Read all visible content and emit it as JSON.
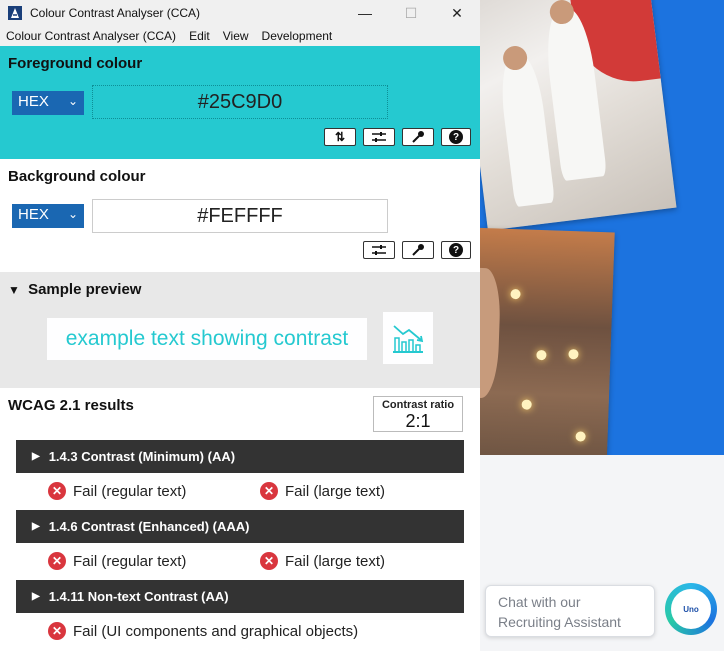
{
  "window": {
    "title": "Colour Contrast Analyser (CCA)",
    "controls": {
      "minimize": "—",
      "maximize": "☐",
      "close": "✕"
    }
  },
  "menu": [
    "Colour Contrast Analyser (CCA)",
    "Edit",
    "View",
    "Development"
  ],
  "foreground": {
    "title": "Foreground colour",
    "format": "HEX",
    "value": "#25C9D0",
    "color": "#25C9D0",
    "tools": [
      "swap-icon",
      "sliders-icon",
      "eyedropper-icon",
      "help-icon"
    ]
  },
  "background": {
    "title": "Background colour",
    "format": "HEX",
    "value": "#FEFFFF",
    "color": "#FEFFFF",
    "tools": [
      "sliders-icon",
      "eyedropper-icon",
      "help-icon"
    ]
  },
  "preview": {
    "title": "Sample preview",
    "toggle": "▼",
    "sample_text": "example text showing contrast"
  },
  "results": {
    "title": "WCAG 2.1 results",
    "ratio_label": "Contrast ratio",
    "ratio_value": "2:1",
    "criteria": [
      {
        "name": "1.4.3 Contrast (Minimum) (AA)",
        "results": [
          "Fail (regular text)",
          "Fail (large text)"
        ]
      },
      {
        "name": "1.4.6 Contrast (Enhanced) (AAA)",
        "results": [
          "Fail (regular text)",
          "Fail (large text)"
        ]
      },
      {
        "name": "1.4.11 Non-text Contrast (AA)",
        "results": [
          "Fail (UI components and graphical objects)"
        ]
      }
    ],
    "fail_color": "#D9363E"
  },
  "chat": {
    "line1": "Chat with our",
    "line2": "Recruiting Assistant",
    "badge": "Uno",
    "edge_char": "t"
  }
}
